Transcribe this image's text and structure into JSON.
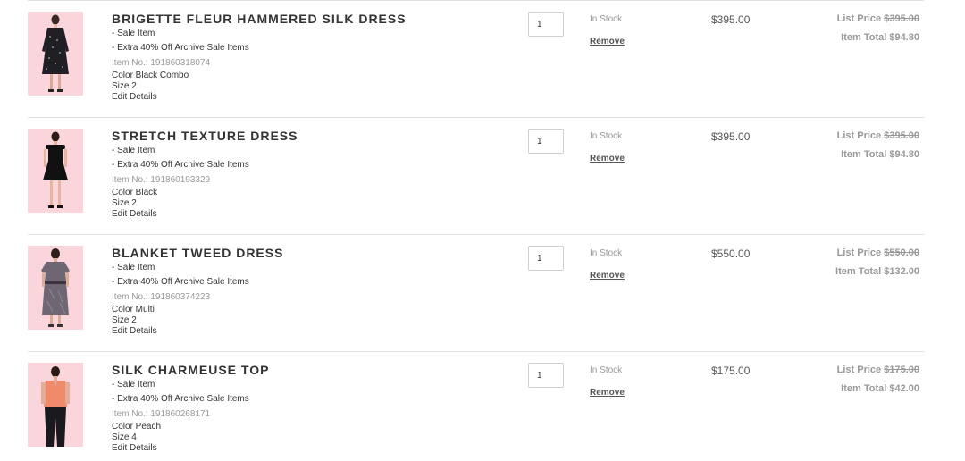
{
  "cart": {
    "items": [
      {
        "name": "BRIGETTE FLEUR HAMMERED SILK DRESS",
        "sale_label": "- Sale Item",
        "promo": "- Extra 40% Off Archive Sale Items",
        "item_no": "Item No.: 191860318074",
        "color": "Color Black Combo",
        "size": "Size 2",
        "edit": "Edit Details",
        "qty": "1",
        "stock": "In Stock",
        "remove": "Remove",
        "price": "$395.00",
        "list_price_label": "List Price",
        "list_price": "$395.00",
        "item_total": "Item Total $94.80",
        "image_icon": "dress-print-black"
      },
      {
        "name": "STRETCH TEXTURE DRESS",
        "sale_label": "- Sale Item",
        "promo": "- Extra 40% Off Archive Sale Items",
        "item_no": "Item No.: 191860193329",
        "color": "Color Black",
        "size": "Size 2",
        "edit": "Edit Details",
        "qty": "1",
        "stock": "In Stock",
        "remove": "Remove",
        "price": "$395.00",
        "list_price_label": "List Price",
        "list_price": "$395.00",
        "item_total": "Item Total $94.80",
        "image_icon": "dress-black"
      },
      {
        "name": "BLANKET TWEED DRESS",
        "sale_label": "- Sale Item",
        "promo": "- Extra 40% Off Archive Sale Items",
        "item_no": "Item No.: 191860374223",
        "color": "Color Multi",
        "size": "Size 2",
        "edit": "Edit Details",
        "qty": "1",
        "stock": "In Stock",
        "remove": "Remove",
        "price": "$550.00",
        "list_price_label": "List Price",
        "list_price": "$550.00",
        "item_total": "Item Total $132.00",
        "image_icon": "dress-tweed"
      },
      {
        "name": "SILK CHARMEUSE TOP",
        "sale_label": "- Sale Item",
        "promo": "- Extra 40% Off Archive Sale Items",
        "item_no": "Item No.: 191860268171",
        "color": "Color Peach",
        "size": "Size 4",
        "edit": "Edit Details",
        "qty": "1",
        "stock": "In Stock",
        "remove": "Remove",
        "price": "$175.00",
        "list_price_label": "List Price",
        "list_price": "$175.00",
        "item_total": "Item Total $42.00",
        "image_icon": "top-peach"
      }
    ]
  },
  "colors": {
    "thumb_bg": "#fbd5dc",
    "divider": "#e3e3e3",
    "muted_text": "#999999",
    "body_text": "#333333"
  }
}
